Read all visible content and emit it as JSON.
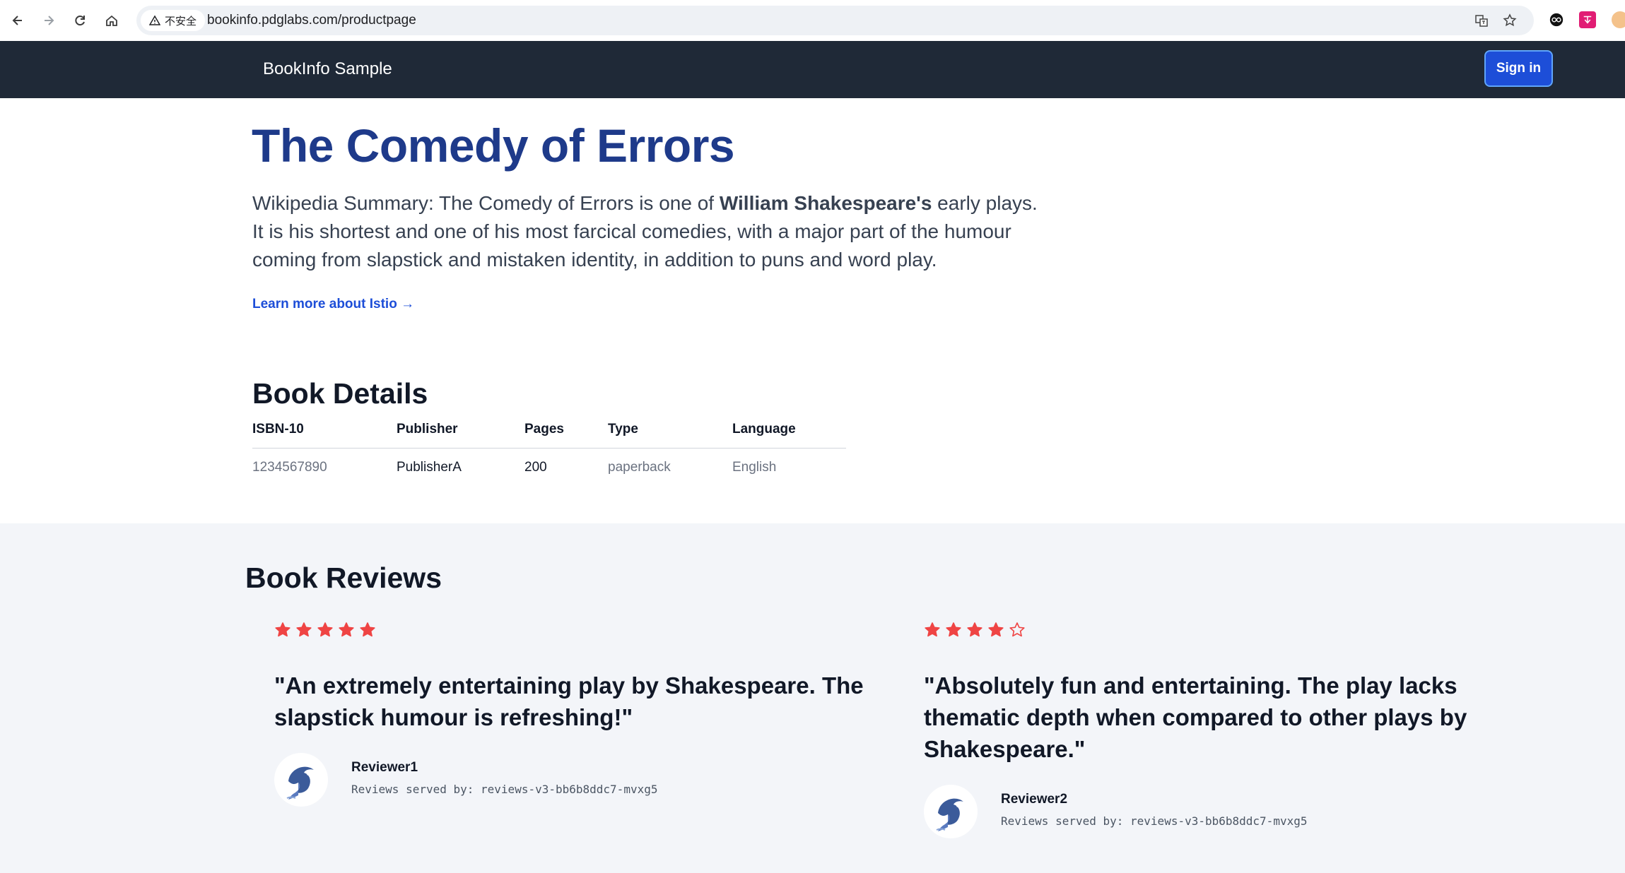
{
  "browser": {
    "security_label": "不安全",
    "url": "bookinfo.pdglabs.com/productpage"
  },
  "navbar": {
    "brand": "BookInfo Sample",
    "signin_label": "Sign in"
  },
  "product": {
    "title": "The Comedy of Errors",
    "summary_prefix": "Wikipedia Summary: The Comedy of Errors is one of ",
    "summary_author": "William Shakespeare's",
    "summary_suffix": " early plays. It is his shortest and one of his most farcical comedies, with a major part of the humour coming from slapstick and mistaken identity, in addition to puns and word play.",
    "learn_more": "Learn more about Istio →"
  },
  "details": {
    "heading": "Book Details",
    "columns": [
      "ISBN-10",
      "Publisher",
      "Pages",
      "Type",
      "Language"
    ],
    "row": [
      "1234567890",
      "PublisherA",
      "200",
      "paperback",
      "English"
    ]
  },
  "reviews": {
    "heading": "Book Reviews",
    "star_color": "#ef4444",
    "items": [
      {
        "rating": 5,
        "text": "\"An extremely entertaining play by Shakespeare. The slapstick humour is refreshing!\"",
        "reviewer": "Reviewer1",
        "served_by": "Reviews served by: reviews-v3-bb6b8ddc7-mvxg5"
      },
      {
        "rating": 4,
        "text": "\"Absolutely fun and entertaining. The play lacks thematic depth when compared to other plays by Shakespeare.\"",
        "reviewer": "Reviewer2",
        "served_by": "Reviews served by: reviews-v3-bb6b8ddc7-mvxg5"
      }
    ]
  }
}
